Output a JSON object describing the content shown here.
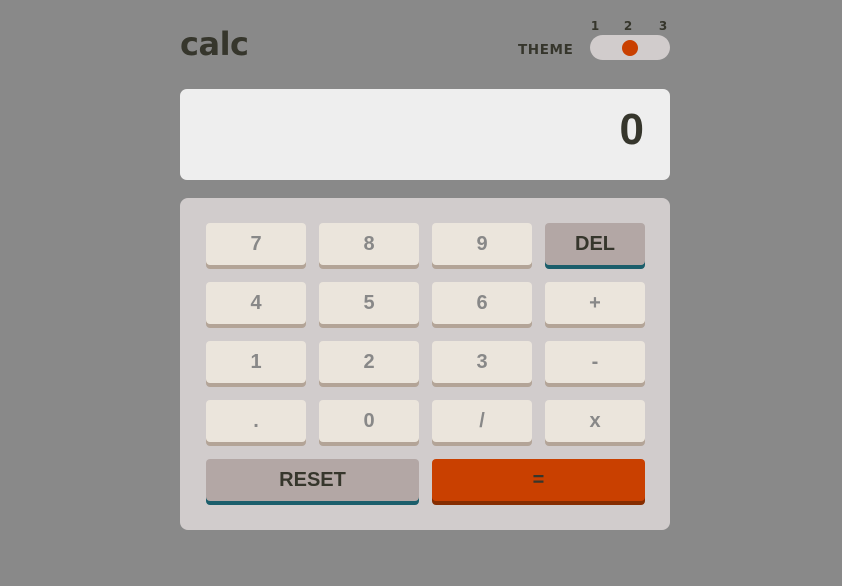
{
  "header": {
    "logo": "calc",
    "theme_label": "THEME",
    "theme_options": [
      "1",
      "2",
      "3"
    ],
    "active_theme": "2"
  },
  "display": {
    "value": "0"
  },
  "keypad": {
    "row1": [
      "7",
      "8",
      "9",
      "DEL"
    ],
    "row2": [
      "4",
      "5",
      "6",
      "+"
    ],
    "row3": [
      "1",
      "2",
      "3",
      "-"
    ],
    "row4": [
      ".",
      "0",
      "/",
      "x"
    ],
    "reset": "RESET",
    "equals": "="
  },
  "colors": {
    "page_background": "#898989",
    "display_background": "#eeeeee",
    "keypad_background": "#d1cccc",
    "key_background": "#ebe5dc",
    "key_shadow": "#b3a497",
    "function_key_background": "#b3a7a5",
    "function_key_shadow": "#1b5e6b",
    "accent": "#c94000",
    "accent_shadow": "#862d00",
    "text_dark": "#36362c",
    "text_key": "#888888"
  }
}
